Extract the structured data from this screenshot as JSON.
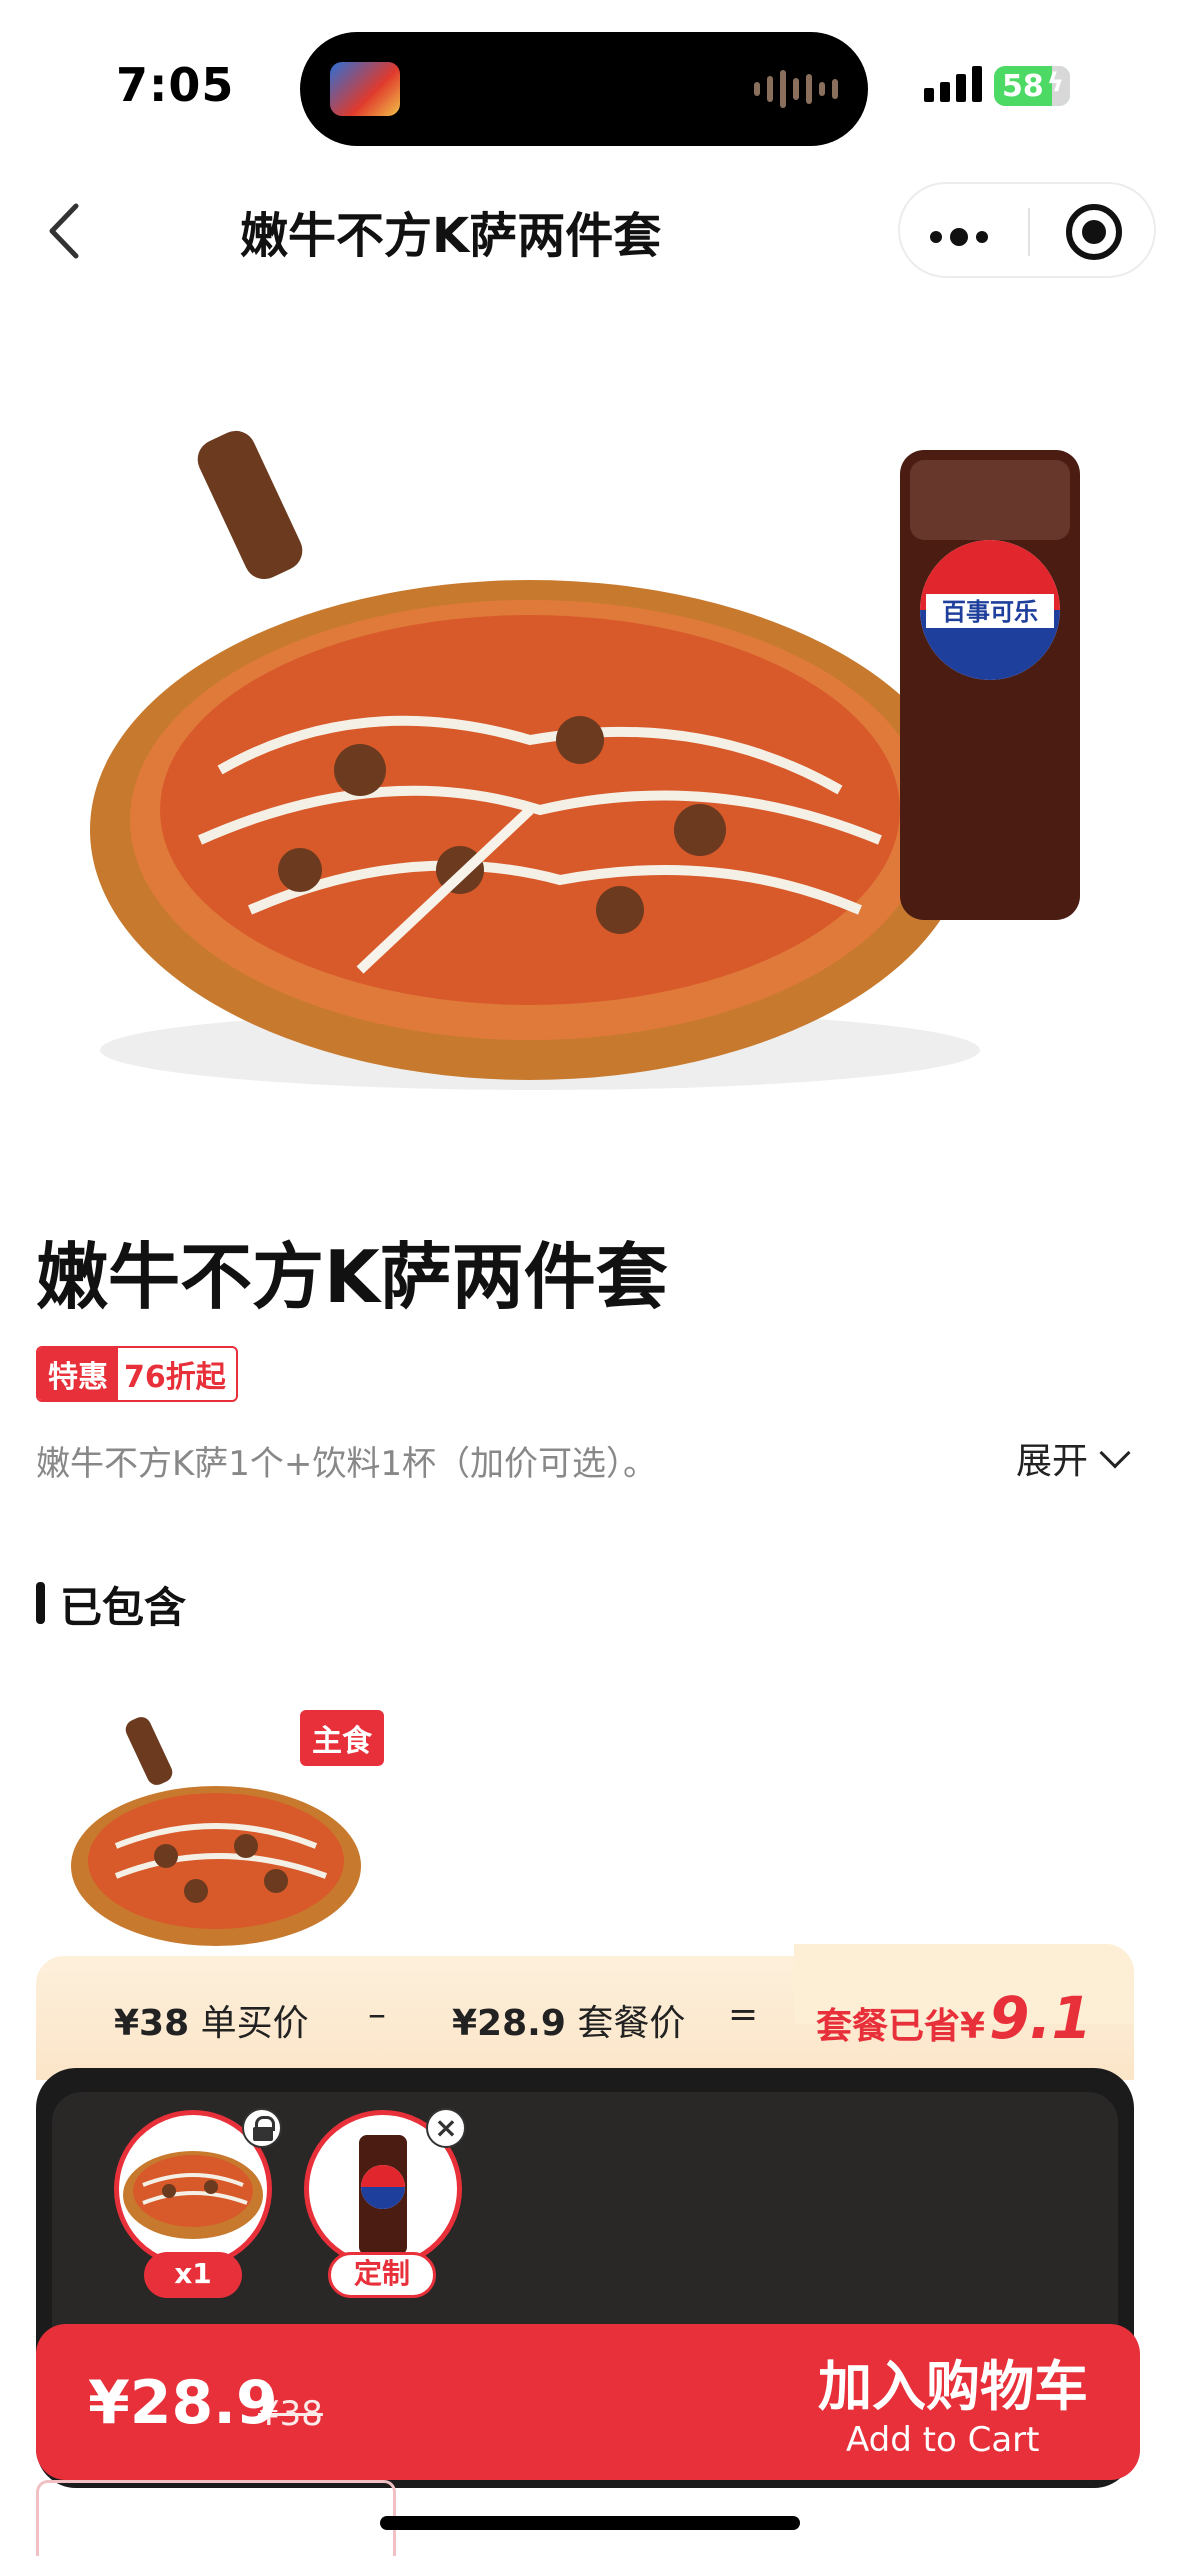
{
  "status": {
    "time": "7:05",
    "battery": "58"
  },
  "nav": {
    "title": "嫩牛不方K萨两件套"
  },
  "product": {
    "title": "嫩牛不方K萨两件套",
    "promo_label": "特惠",
    "promo_value": "76折起",
    "description": "嫩牛不方K萨1个+饮料1杯（加价可选）。",
    "expand_label": "展开"
  },
  "included": {
    "section_title": "已包含",
    "main_tag": "主食"
  },
  "savings": {
    "single_price": "¥38",
    "single_label": "单买价",
    "minus": "–",
    "set_price": "¥28.9",
    "set_label": "套餐价",
    "equals": "=",
    "saved_label": "套餐已省¥",
    "saved_amount": "9.1"
  },
  "selection": {
    "item1_qty": "x1",
    "item2_action": "定制"
  },
  "cart": {
    "price": "¥28.9",
    "original_price": "¥38",
    "button_cn": "加入购物车",
    "button_en": "Add to Cart"
  },
  "colors": {
    "accent": "#e8303a",
    "savings_bg": "#fdf0db",
    "panel_bg": "#1b1b1b"
  }
}
